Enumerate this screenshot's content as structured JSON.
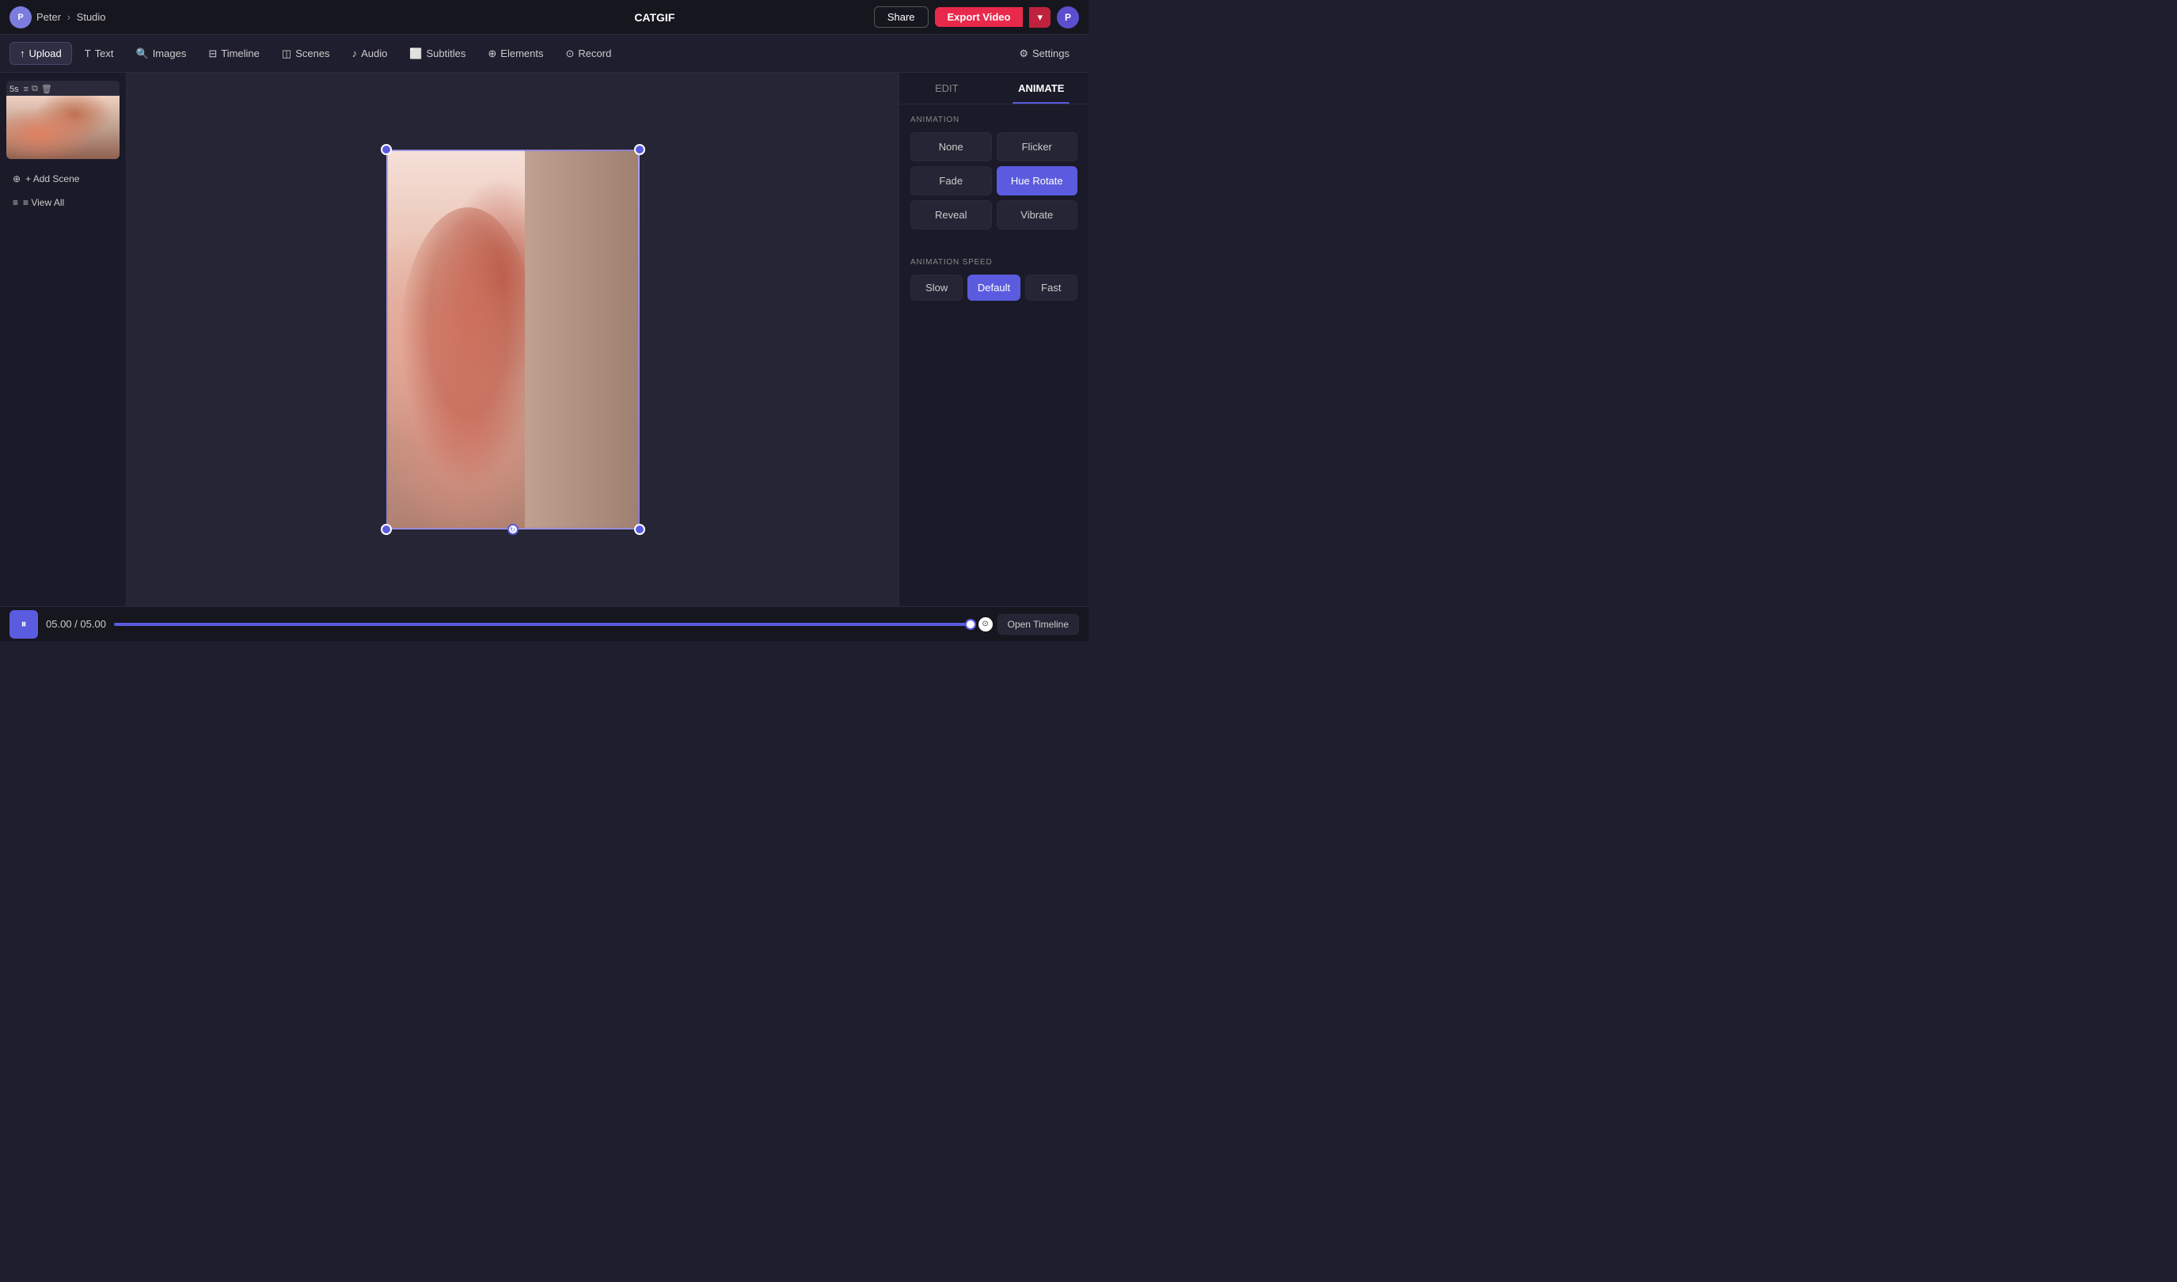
{
  "topbar": {
    "user_name": "Peter",
    "breadcrumb_sep": "›",
    "studio_label": "Studio",
    "project_title": "CATGIF",
    "share_label": "Share",
    "export_label": "Export Video",
    "user_initial": "P"
  },
  "toolbar": {
    "upload_label": "Upload",
    "text_label": "Text",
    "images_label": "Images",
    "timeline_label": "Timeline",
    "scenes_label": "Scenes",
    "audio_label": "Audio",
    "subtitles_label": "Subtitles",
    "elements_label": "Elements",
    "record_label": "Record",
    "settings_label": "Settings"
  },
  "sidebar": {
    "scene_time": "5s",
    "add_scene_label": "+ Add Scene",
    "view_all_label": "≡ View All"
  },
  "panel": {
    "edit_tab": "EDIT",
    "animate_tab": "ANIMATE",
    "animation_section_label": "ANIMATION",
    "animation_buttons": [
      {
        "id": "none",
        "label": "None",
        "selected": false
      },
      {
        "id": "flicker",
        "label": "Flicker",
        "selected": false
      },
      {
        "id": "fade",
        "label": "Fade",
        "selected": false
      },
      {
        "id": "hue-rotate",
        "label": "Hue Rotate",
        "selected": true
      },
      {
        "id": "reveal",
        "label": "Reveal",
        "selected": false
      },
      {
        "id": "vibrate",
        "label": "Vibrate",
        "selected": false
      }
    ],
    "speed_section_label": "ANIMATION SPEED",
    "speed_buttons": [
      {
        "id": "slow",
        "label": "Slow",
        "selected": false
      },
      {
        "id": "default",
        "label": "Default",
        "selected": true
      },
      {
        "id": "fast",
        "label": "Fast",
        "selected": false
      }
    ]
  },
  "bottombar": {
    "current_time": "05.00",
    "total_time": "05.00",
    "time_separator": "/",
    "open_timeline_label": "Open Timeline"
  },
  "icons": {
    "upload": "↑",
    "text": "T",
    "images": "🔍",
    "timeline": "⊟",
    "scenes": "◫",
    "audio": "♪",
    "subtitles": "⬜",
    "elements": "⊕",
    "record": "⊙",
    "settings": "⚙",
    "add_scene": "+",
    "view_all": "≡",
    "pause": "⏸",
    "timeline_circle": "⊙"
  }
}
